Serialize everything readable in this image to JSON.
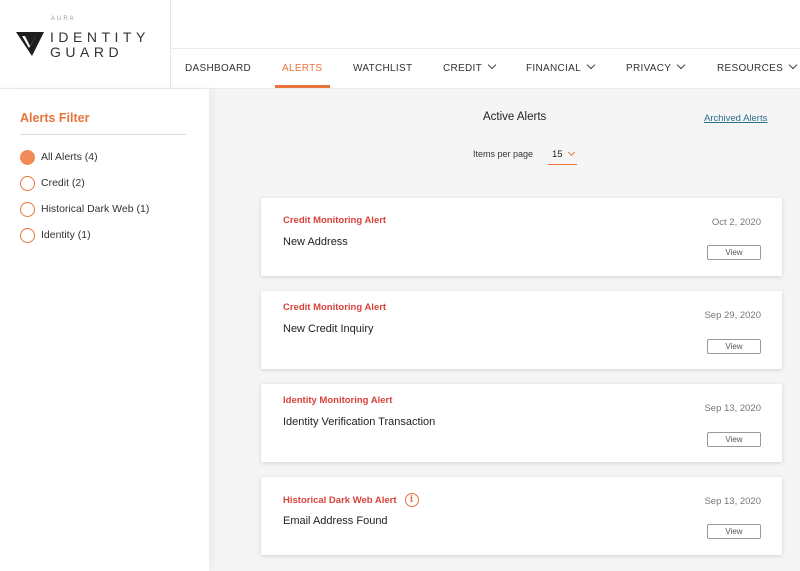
{
  "brand": {
    "aura": "AURA",
    "line1": "IDENTITY",
    "line2": "GUARD",
    "accent_color": "#e8743b"
  },
  "nav": {
    "items": [
      {
        "label": "DASHBOARD",
        "dropdown": false
      },
      {
        "label": "ALERTS",
        "dropdown": false,
        "active": true
      },
      {
        "label": "WATCHLIST",
        "dropdown": false
      },
      {
        "label": "CREDIT",
        "dropdown": true
      },
      {
        "label": "FINANCIAL",
        "dropdown": true
      },
      {
        "label": "PRIVACY",
        "dropdown": true
      },
      {
        "label": "RESOURCES",
        "dropdown": true
      }
    ]
  },
  "sidebar": {
    "title": "Alerts Filter",
    "filters": [
      {
        "label": "All Alerts (4)",
        "checked": true
      },
      {
        "label": "Credit (2)",
        "checked": false
      },
      {
        "label": "Historical Dark Web (1)",
        "checked": false
      },
      {
        "label": "Identity (1)",
        "checked": false
      }
    ]
  },
  "main": {
    "title": "Active Alerts",
    "archived_link": "Archived Alerts",
    "items_per_page_label": "Items per page",
    "items_per_page_value": "15",
    "view_label": "View",
    "alerts": [
      {
        "type": "Credit Monitoring Alert",
        "title": "New Address",
        "date": "Oct 2, 2020",
        "info": false
      },
      {
        "type": "Credit Monitoring Alert",
        "title": "New Credit Inquiry",
        "date": "Sep 29, 2020",
        "info": false
      },
      {
        "type": "Identity Monitoring Alert",
        "title": "Identity Verification Transaction",
        "date": "Sep 13, 2020",
        "info": false
      },
      {
        "type": "Historical Dark Web Alert",
        "title": "Email Address Found",
        "date": "Sep 13, 2020",
        "info": true,
        "info_icon": "info-icon"
      }
    ]
  }
}
